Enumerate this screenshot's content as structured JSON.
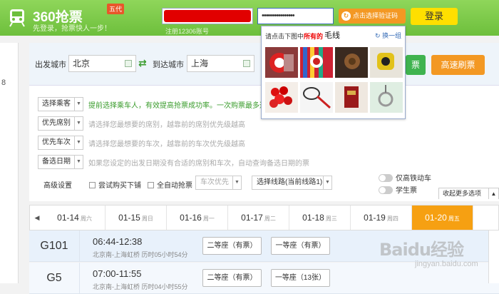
{
  "header": {
    "title": "360抢票",
    "version": "五代",
    "subtitle": "先登录，抢票快人一步！",
    "user_hint": "注册12306账号",
    "password_mask": "••••••••••••••••",
    "captcha_label": "点击选择验证码",
    "login_label": "登录"
  },
  "sidebar": {
    "items": [
      "8",
      "",
      "",
      "",
      "",
      ""
    ]
  },
  "search": {
    "from_label": "出发城市",
    "from_value": "北京",
    "to_label": "到达城市",
    "to_value": "上海",
    "query_label": "票",
    "fast_label": "高速刷票"
  },
  "options": [
    {
      "select": "选择乘客",
      "text": "提前选择乘车人，有效提高抢票成功率。一次购票最多选择"
    },
    {
      "select": "优先席别",
      "text": "请选择您最想要的席别，越靠前的席别优先级越高"
    },
    {
      "select": "优先车次",
      "text": "请选择您最想要的车次，越靠前的车次优先级越高"
    },
    {
      "select": "备选日期",
      "text": "如果您设定的出发日期没有合适的席别和车次，自动查询备选日期的票"
    }
  ],
  "advanced": {
    "label": "高级设置",
    "try_standing": "尝试购买下铺",
    "auto_grab": "全自动抢票",
    "priority": "车次优先",
    "route": "选择线路(当前线路1)",
    "only_hs": "仅高铁动车",
    "student": "学生票",
    "collapse": "收起更多选项"
  },
  "dates": [
    {
      "date": "01-14",
      "day": "周六"
    },
    {
      "date": "01-15",
      "day": "周日"
    },
    {
      "date": "01-16",
      "day": "周一"
    },
    {
      "date": "01-17",
      "day": "周二"
    },
    {
      "date": "01-18",
      "day": "周三"
    },
    {
      "date": "01-19",
      "day": "周四"
    },
    {
      "date": "01-20",
      "day": "周五"
    }
  ],
  "trains": [
    {
      "num": "G101",
      "time": "06:44-12:38",
      "info": "北京南-上海虹桥 历时05小时54分",
      "seat1": "二等座（有票）",
      "seat2": "一等座（有票）"
    },
    {
      "num": "G5",
      "time": "07:00-11:55",
      "info": "北京南-上海虹桥 历时04小时55分",
      "seat1": "二等座（有票）",
      "seat2": "一等座（13张）"
    }
  ],
  "captcha": {
    "prompt": "请点击下图中",
    "prompt_em": "所有的",
    "word": "毛线",
    "refresh": "换一组"
  },
  "watermark": {
    "main": "Baidu经验",
    "sub": "jingyan.baidu.com"
  },
  "colors": {
    "header": "#6dbf3c",
    "accent": "#f39823",
    "selected_date": "#f6a012",
    "query_btn": "#3fb34f"
  }
}
